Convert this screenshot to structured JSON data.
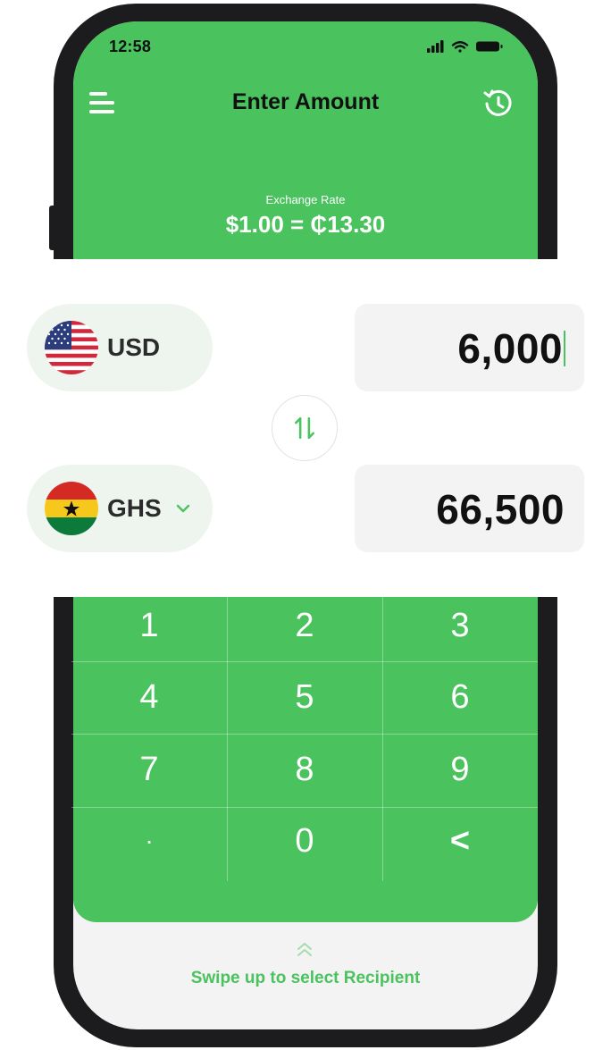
{
  "status_bar": {
    "time": "12:58",
    "icons": [
      "signal-icon",
      "wifi-icon",
      "battery-icon"
    ]
  },
  "header": {
    "title": "Enter Amount",
    "left_icon": "menu-icon",
    "right_icon": "history-icon"
  },
  "exchange_rate": {
    "label": "Exchange Rate",
    "value": "$1.00 = ₵13.30"
  },
  "send": {
    "currency": "USD",
    "flag": "us-flag",
    "amount": "6,000"
  },
  "receive": {
    "currency": "GHS",
    "flag": "ghana-flag",
    "amount": "66,500",
    "dropdown_icon": "chevron-down-icon"
  },
  "swap_icon": "swap-arrows-icon",
  "keypad": {
    "keys": [
      "1",
      "2",
      "3",
      "4",
      "5",
      "6",
      "7",
      "8",
      "9",
      "·",
      "0",
      "<"
    ]
  },
  "swipe": {
    "icon": "double-chevron-up-icon",
    "label": "Swipe up to select Recipient"
  },
  "colors": {
    "accent": "#4ac25e",
    "pill": "#eef5ef",
    "amount_bg": "#f3f3f3",
    "frame": "#1c1c1e"
  }
}
